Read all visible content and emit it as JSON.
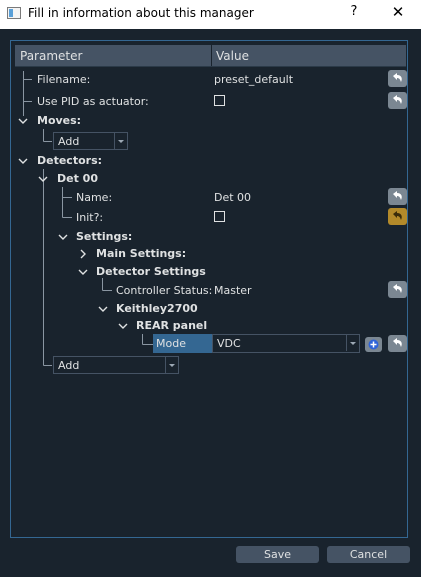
{
  "window": {
    "title": "Fill in information about this manager",
    "help_label": "?",
    "close_label": "✕"
  },
  "tree": {
    "headers": {
      "parameter": "Parameter",
      "value": "Value"
    },
    "filename": {
      "label": "Filename:",
      "value": "preset_default"
    },
    "use_pid": {
      "label": "Use PID as actuator:",
      "checked": false
    },
    "moves": {
      "label": "Moves:",
      "add_label": "Add"
    },
    "detectors": {
      "label": "Detectors:",
      "det00": {
        "label": "Det 00",
        "name": {
          "label": "Name:",
          "value": "Det 00"
        },
        "init": {
          "label": "Init?:",
          "checked": false
        },
        "settings": {
          "label": "Settings:",
          "main_settings": "Main Settings:",
          "detector_settings": {
            "label": "Detector Settings",
            "controller_status": {
              "label": "Controller Status:",
              "value": "Master"
            },
            "keithley": {
              "label": "Keithley2700",
              "rear_panel": {
                "label": "REAR panel",
                "mode": {
                  "label": "Mode",
                  "value": "VDC"
                }
              }
            }
          }
        }
      },
      "add_label": "Add"
    }
  },
  "buttons": {
    "save": "Save",
    "cancel": "Cancel"
  },
  "colors": {
    "background": "#19232d",
    "header": "#455364",
    "selection": "#346792",
    "reset_active": "#b38a2a"
  }
}
